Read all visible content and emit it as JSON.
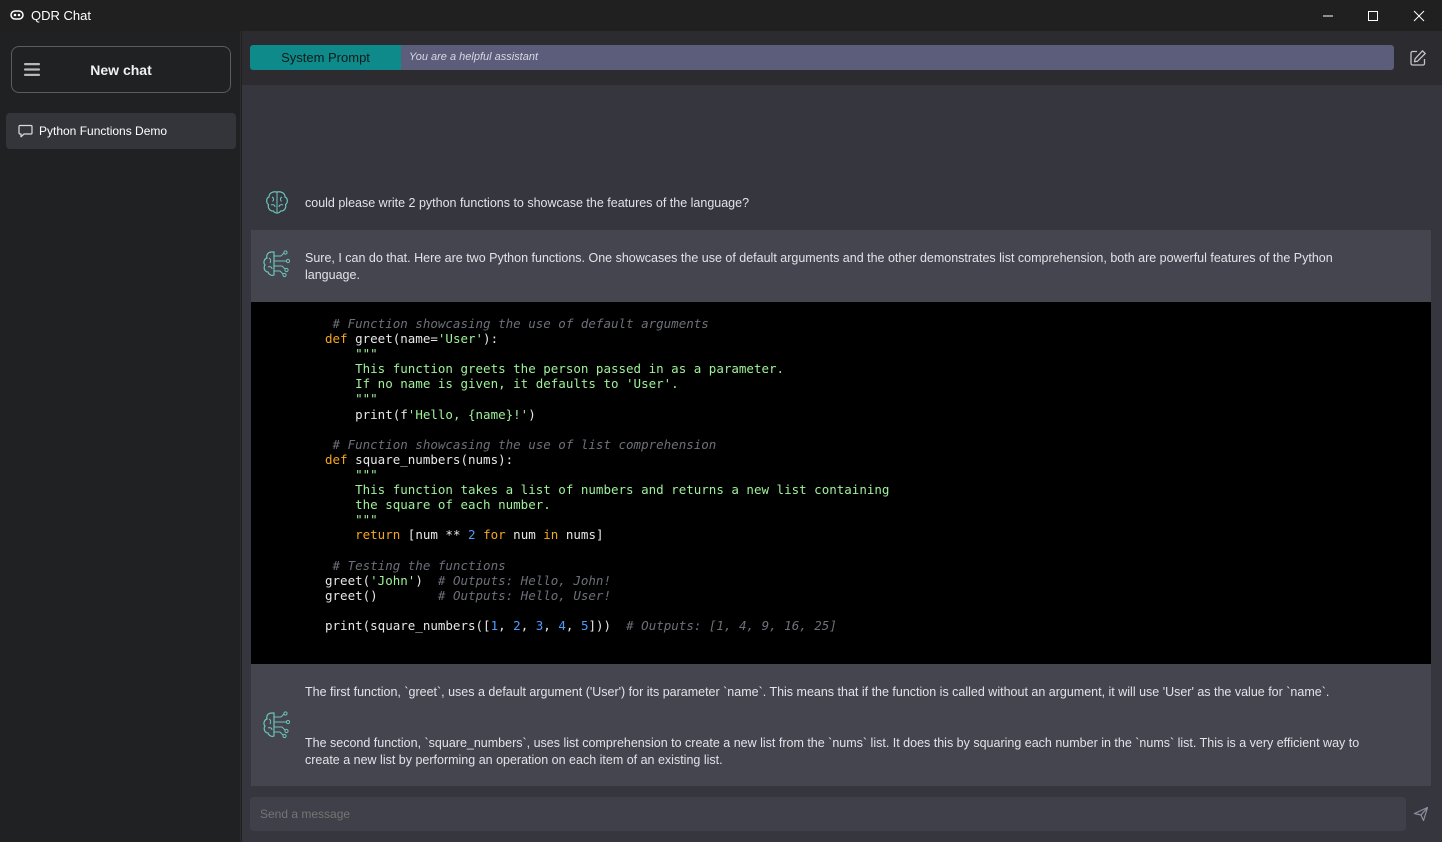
{
  "window": {
    "title": "QDR Chat"
  },
  "sidebar": {
    "new_chat_label": "New chat",
    "conversations": [
      {
        "label": "Python Functions Demo"
      }
    ]
  },
  "system_prompt": {
    "label": "System Prompt",
    "value": "You are a helpful assistant"
  },
  "messages": {
    "user_1": "could please write 2 python functions to showcase the features of the language?",
    "bot_1": "Sure, I can do that. Here are two Python functions. One showcases the use of default arguments and the other demonstrates list comprehension, both are powerful features of the Python language.",
    "bot_2_p1": "The first function, `greet`, uses a default argument ('User') for its parameter `name`. This means that if the function is called without an argument, it will use 'User' as the value for `name`.",
    "bot_2_p2": "The second function, `square_numbers`, uses list comprehension to create a new list from the `nums` list. It does this by squaring each number in the `nums` list. This is a very efficient way to create a new list by performing an operation on each item of an existing list."
  },
  "code": {
    "lines": [
      [
        {
          "t": " # Function showcasing the use of default arguments",
          "c": "com"
        }
      ],
      [
        {
          "t": "def",
          "c": "kw"
        },
        {
          "t": " greet(name="
        },
        {
          "t": "'User'",
          "c": "str"
        },
        {
          "t": "):"
        }
      ],
      [
        {
          "t": "    \"\"\"",
          "c": "doc"
        }
      ],
      [
        {
          "t": "    This function greets the person passed in as a parameter.",
          "c": "doc"
        }
      ],
      [
        {
          "t": "    If no name is given, it defaults to 'User'.",
          "c": "doc"
        }
      ],
      [
        {
          "t": "    \"\"\"",
          "c": "doc"
        }
      ],
      [
        {
          "t": "    print(f"
        },
        {
          "t": "'Hello, {name}!'",
          "c": "str"
        },
        {
          "t": ")"
        }
      ],
      [
        {
          "t": ""
        }
      ],
      [
        {
          "t": " # Function showcasing the use of list comprehension",
          "c": "com"
        }
      ],
      [
        {
          "t": "def",
          "c": "kw"
        },
        {
          "t": " square_numbers(nums):"
        }
      ],
      [
        {
          "t": "    \"\"\"",
          "c": "doc"
        }
      ],
      [
        {
          "t": "    This function takes a list of numbers and returns a new list containing",
          "c": "doc"
        }
      ],
      [
        {
          "t": "    the square of each number.",
          "c": "doc"
        }
      ],
      [
        {
          "t": "    \"\"\"",
          "c": "doc"
        }
      ],
      [
        {
          "t": "    "
        },
        {
          "t": "return",
          "c": "kw"
        },
        {
          "t": " [num ** "
        },
        {
          "t": "2",
          "c": "num"
        },
        {
          "t": " "
        },
        {
          "t": "for",
          "c": "kw"
        },
        {
          "t": " num "
        },
        {
          "t": "in",
          "c": "kw"
        },
        {
          "t": " nums]"
        }
      ],
      [
        {
          "t": ""
        }
      ],
      [
        {
          "t": " # Testing the functions",
          "c": "com"
        }
      ],
      [
        {
          "t": "greet("
        },
        {
          "t": "'John'",
          "c": "str"
        },
        {
          "t": ")  "
        },
        {
          "t": "# Outputs: Hello, John!",
          "c": "com"
        }
      ],
      [
        {
          "t": "greet()        "
        },
        {
          "t": "# Outputs: Hello, User!",
          "c": "com"
        }
      ],
      [
        {
          "t": ""
        }
      ],
      [
        {
          "t": "print(square_numbers(["
        },
        {
          "t": "1",
          "c": "num"
        },
        {
          "t": ", "
        },
        {
          "t": "2",
          "c": "num"
        },
        {
          "t": ", "
        },
        {
          "t": "3",
          "c": "num"
        },
        {
          "t": ", "
        },
        {
          "t": "4",
          "c": "num"
        },
        {
          "t": ", "
        },
        {
          "t": "5",
          "c": "num"
        },
        {
          "t": "]))  "
        },
        {
          "t": "# Outputs: [1, 4, 9, 16, 25]",
          "c": "com"
        }
      ]
    ]
  },
  "input": {
    "placeholder": "Send a message"
  },
  "icons": {
    "app": "app-logo-icon",
    "minimize": "minimize-icon",
    "maximize": "maximize-icon",
    "close": "close-icon",
    "menu": "hamburger-menu-icon",
    "chat": "chat-bubble-icon",
    "edit": "edit-icon",
    "avatar": "brain-icon",
    "send": "send-icon"
  },
  "colors": {
    "accent": "#0f8a8a",
    "system_value_bg": "#5b5d7b",
    "bot_bg": "#44454f",
    "main_bg": "#36363f",
    "sidebar_bg": "#202123"
  }
}
